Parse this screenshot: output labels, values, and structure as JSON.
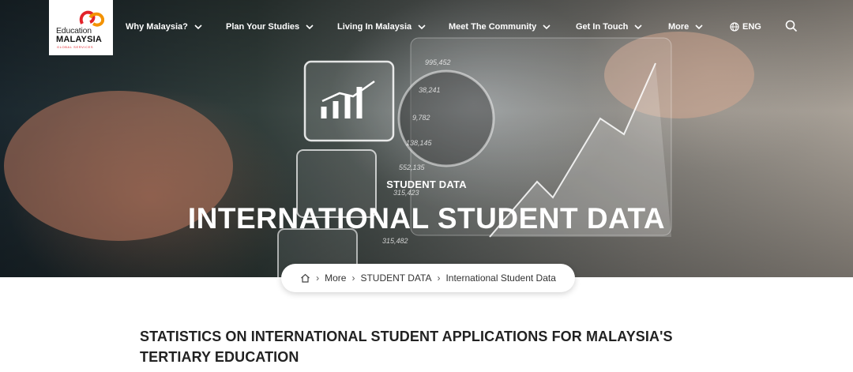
{
  "logo": {
    "line1": "Education",
    "line2": "MALAYSIA",
    "line3": "GLOBAL SERVICES"
  },
  "nav": {
    "items": [
      {
        "label": "Why Malaysia?"
      },
      {
        "label": "Plan Your Studies"
      },
      {
        "label": "Living In Malaysia"
      },
      {
        "label": "Meet The Community"
      },
      {
        "label": "Get In Touch"
      },
      {
        "label": "More"
      }
    ],
    "language": "ENG"
  },
  "hero": {
    "kicker": "STUDENT DATA",
    "title": "INTERNATIONAL STUDENT DATA",
    "overlay_numbers": [
      "995,452",
      "38,241",
      "9,782",
      "138,145",
      "552,135",
      "315,423",
      "315,482"
    ]
  },
  "breadcrumb": {
    "items": [
      "More",
      "STUDENT DATA",
      "International Student Data"
    ]
  },
  "section": {
    "title": "STATISTICS ON INTERNATIONAL STUDENT APPLICATIONS FOR MALAYSIA'S TERTIARY EDUCATION"
  },
  "colors": {
    "brand_red": "#e2232a",
    "brand_orange": "#f39200",
    "text_dark": "#222222"
  },
  "icons": [
    "globe-icon",
    "search-icon",
    "home-icon",
    "chevron-down-icon",
    "chevron-right-icon"
  ]
}
